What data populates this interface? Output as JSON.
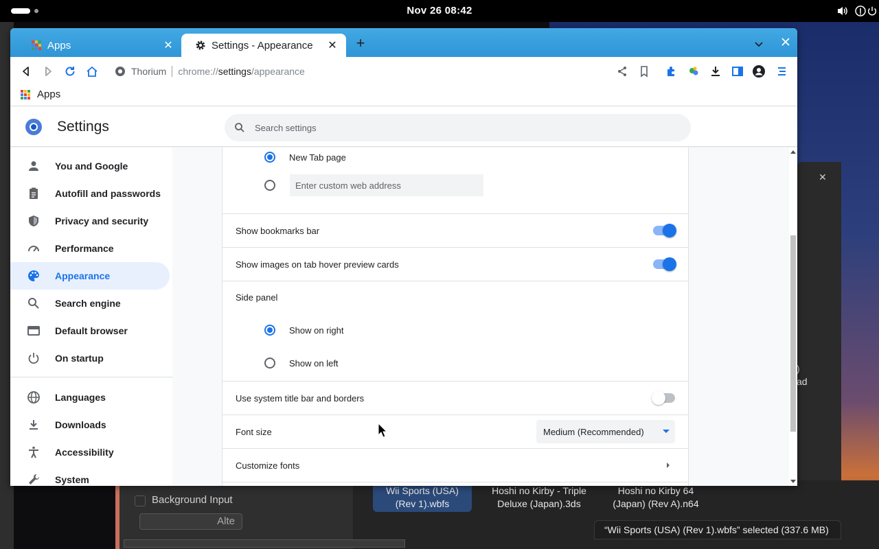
{
  "system": {
    "clock": "Nov 26  08:42"
  },
  "background": {
    "input_label": "Background Input",
    "input_button": "Alte",
    "files": [
      "Wii Sports (USA) (Rev 1).wbfs",
      "Hoshi no Kirby - Triple Deluxe (Japan).3ds",
      "Hoshi no Kirby 64 (Japan) (Rev A).n64"
    ],
    "status": "“Wii Sports (USA) (Rev 1).wbfs” selected  (337.6 MB)",
    "right_text": ")\nad"
  },
  "browser": {
    "tabs": [
      {
        "label": "Apps",
        "icon": "apps-grid-icon"
      },
      {
        "label": "Settings - Appearance",
        "icon": "gear-icon"
      }
    ],
    "omnibox": {
      "site_name": "Thorium",
      "url_scheme": "chrome://",
      "url_host": "settings",
      "url_path": "/appearance"
    },
    "bookmarks": [
      {
        "label": "Apps",
        "icon": "apps-grid-icon"
      }
    ]
  },
  "settings": {
    "title": "Settings",
    "search_placeholder": "Search settings",
    "nav": [
      {
        "label": "You and Google",
        "icon": "person-icon"
      },
      {
        "label": "Autofill and passwords",
        "icon": "clipboard-icon"
      },
      {
        "label": "Privacy and security",
        "icon": "shield-icon"
      },
      {
        "label": "Performance",
        "icon": "speedometer-icon"
      },
      {
        "label": "Appearance",
        "icon": "palette-icon",
        "active": true
      },
      {
        "label": "Search engine",
        "icon": "search-icon"
      },
      {
        "label": "Default browser",
        "icon": "browser-icon"
      },
      {
        "label": "On startup",
        "icon": "power-icon"
      },
      {
        "label": "Languages",
        "icon": "globe-icon"
      },
      {
        "label": "Downloads",
        "icon": "download-icon"
      },
      {
        "label": "Accessibility",
        "icon": "accessibility-icon"
      },
      {
        "label": "System",
        "icon": "wrench-icon"
      }
    ],
    "appearance": {
      "home_new_tab_label": "New Tab page",
      "home_custom_placeholder": "Enter custom web address",
      "show_bookmarks_bar": {
        "label": "Show bookmarks bar",
        "enabled": true
      },
      "show_images_hover": {
        "label": "Show images on tab hover preview cards",
        "enabled": true
      },
      "side_panel": {
        "label": "Side panel",
        "options": [
          "Show on right",
          "Show on left"
        ],
        "selected": "Show on right"
      },
      "system_title_bar": {
        "label": "Use system title bar and borders",
        "enabled": false
      },
      "font_size": {
        "label": "Font size",
        "value": "Medium (Recommended)"
      },
      "customize_fonts": "Customize fonts"
    }
  },
  "colors": {
    "accent": "#1a73e8",
    "tabstrip": "#3a9fdf",
    "active_nav_bg": "#e8f0fe"
  }
}
